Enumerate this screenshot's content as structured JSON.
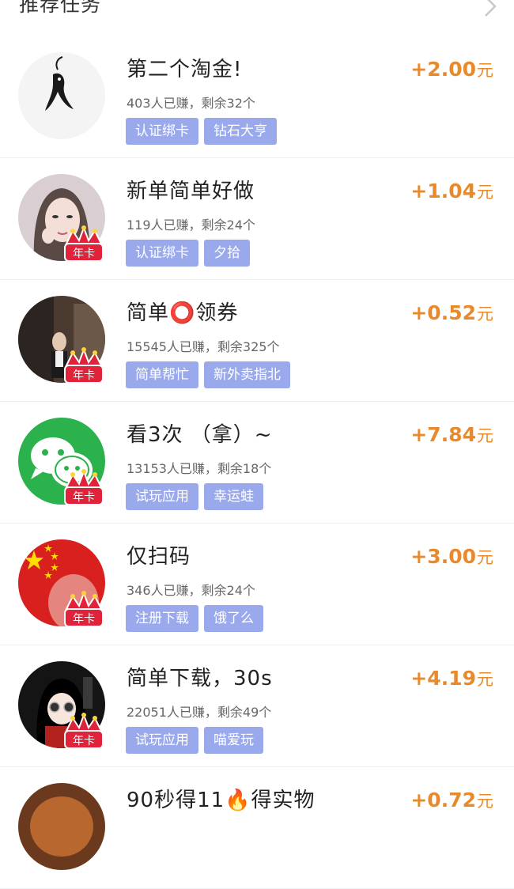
{
  "header": {
    "title": "推荐任务"
  },
  "tasks": [
    {
      "title": "第二个淘金!",
      "meta": "403人已赚，剩余32个",
      "tags": [
        "认证绑卡",
        "钻石大亨"
      ],
      "reward": "+2.00",
      "unit": "元",
      "avatar": "fish-ink-avatar",
      "badge": ""
    },
    {
      "title": "新单简单好做",
      "meta": "119人已赚，剩余24个",
      "tags": [
        "认证绑卡",
        "夕拾"
      ],
      "reward": "+1.04",
      "unit": "元",
      "avatar": "girl-photo-avatar",
      "badge": "年卡"
    },
    {
      "title": "简单⭕领券",
      "meta": "15545人已赚，剩余325个",
      "tags": [
        "简单帮忙",
        "新外卖指北"
      ],
      "reward": "+0.52",
      "unit": "元",
      "avatar": "man-dark-room-avatar",
      "badge": "年卡"
    },
    {
      "title": "看3次 （拿）~",
      "meta": "13153人已赚，剩余18个",
      "tags": [
        "试玩应用",
        "幸运蛙"
      ],
      "reward": "+7.84",
      "unit": "元",
      "avatar": "wechat-logo-avatar",
      "badge": "年卡"
    },
    {
      "title": "仅扫码",
      "meta": "346人已赚，剩余24个",
      "tags": [
        "注册下载",
        "饿了么"
      ],
      "reward": "+3.00",
      "unit": "元",
      "avatar": "red-flag-avatar",
      "badge": "年卡"
    },
    {
      "title": "简单下载，30s",
      "meta": "22051人已赚，剩余49个",
      "tags": [
        "试玩应用",
        "喵爱玩"
      ],
      "reward": "+4.19",
      "unit": "元",
      "avatar": "cartoon-girl-avatar",
      "badge": "年卡"
    },
    {
      "title": "90秒得11🔥得实物",
      "meta": "",
      "tags": [],
      "reward": "+0.72",
      "unit": "元",
      "avatar": "orange-avatar",
      "badge": ""
    }
  ],
  "colors": {
    "reward": "#e88a2c",
    "tag_bg": "#9aa9ec",
    "wechat_green": "#2bb24c",
    "crown_red": "#e0233a"
  },
  "icons": {
    "header_chevron": "chevron-right-icon",
    "badge_crown": "crown-icon"
  }
}
